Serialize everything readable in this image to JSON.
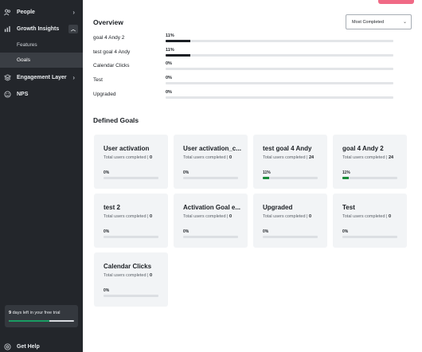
{
  "sidebar": {
    "items": [
      {
        "label": "People",
        "icon": "people-icon"
      },
      {
        "label": "Growth Insights",
        "icon": "bar-chart-icon"
      },
      {
        "label": "Engagement Layer",
        "icon": "layers-icon"
      },
      {
        "label": "NPS",
        "icon": "nps-icon"
      }
    ],
    "subitems": [
      {
        "label": "Features"
      },
      {
        "label": "Goals"
      }
    ],
    "trial": {
      "days": "9",
      "text": "days left in your free trial",
      "progress": 0.62
    },
    "help_label": "Get Help"
  },
  "main": {
    "overview_title": "Overview",
    "sort_dropdown": {
      "selected": "Most Completed"
    },
    "overview_rows": [
      {
        "label": "goal 4 Andy 2",
        "pct": "11%",
        "value": 0.11
      },
      {
        "label": "test goal 4 Andy",
        "pct": "11%",
        "value": 0.11
      },
      {
        "label": "Calendar Clicks",
        "pct": "0%",
        "value": 0
      },
      {
        "label": "Test",
        "pct": "0%",
        "value": 0
      },
      {
        "label": "Upgraded",
        "pct": "0%",
        "value": 0
      }
    ],
    "defined_title": "Defined Goals",
    "goal_sub_label": "Total users completed |",
    "goals": [
      {
        "title": "User activation",
        "count": "0",
        "pct": "0%",
        "value": 0
      },
      {
        "title": "User activation_c...",
        "count": "0",
        "pct": "0%",
        "value": 0
      },
      {
        "title": "test goal 4 Andy",
        "count": "24",
        "pct": "11%",
        "value": 0.11
      },
      {
        "title": "goal 4 Andy 2",
        "count": "24",
        "pct": "11%",
        "value": 0.11
      },
      {
        "title": "test 2",
        "count": "0",
        "pct": "0%",
        "value": 0
      },
      {
        "title": "Activation Goal e...",
        "count": "0",
        "pct": "0%",
        "value": 0
      },
      {
        "title": "Upgraded",
        "count": "0",
        "pct": "0%",
        "value": 0
      },
      {
        "title": "Test",
        "count": "0",
        "pct": "0%",
        "value": 0
      },
      {
        "title": "Calendar Clicks",
        "count": "0",
        "pct": "0%",
        "value": 0
      }
    ]
  },
  "colors": {
    "accent": "#f06a86",
    "progress_green": "#1a8c3a",
    "sidebar_bg": "#23262b"
  }
}
